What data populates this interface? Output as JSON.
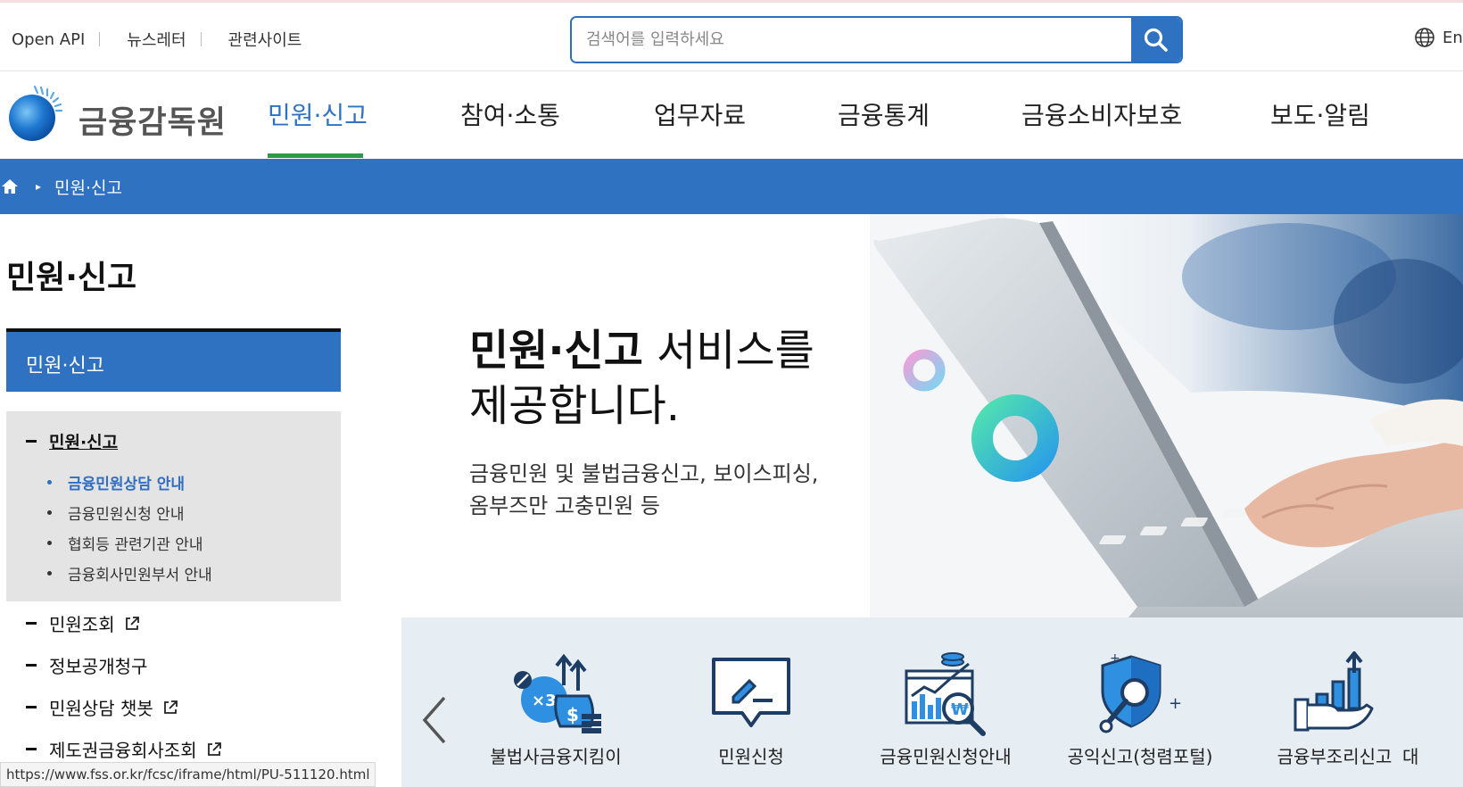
{
  "utility": {
    "links": [
      "Open API",
      "뉴스레터",
      "관련사이트"
    ],
    "search_placeholder": "검색어를 입력하세요",
    "lang_label": "En"
  },
  "header": {
    "logo_text": "금융감독원",
    "gnb": [
      "민원·신고",
      "참여·소통",
      "업무자료",
      "금융통계",
      "금융소비자보호",
      "보도·알림"
    ],
    "active_index": 0
  },
  "breadcrumb": {
    "current": "민원·신고"
  },
  "sidebar": {
    "title": "민원·신고",
    "box_title": "민원·신고",
    "current_group": "민원·신고",
    "sub_items": [
      "금융민원상담 안내",
      "금융민원신청 안내",
      "협회등 관련기관 안내",
      "금융회사민원부서 안내"
    ],
    "active_sub_index": 0,
    "other_items": [
      "민원조회",
      "정보공개청구",
      "민원상담 챗봇",
      "제도권금융회사조회"
    ]
  },
  "hero": {
    "title_bold": "민원·신고",
    "title_rest": " 서비스를",
    "title_line2": "제공합니다.",
    "desc_line1": "금융민원 및 불법금융신고, 보이스피싱,",
    "desc_line2": "옴부즈만 고충민원 등"
  },
  "quick_menu": {
    "items": [
      "불법사금융지킴이",
      "민원신청",
      "금융민원신청안내",
      "공익신고(청렴포털)",
      "금융부조리신고",
      "대"
    ]
  },
  "status_bar": {
    "url": "https://www.fss.or.kr/fcsc/iframe/html/PU-511120.html"
  },
  "colors": {
    "primary_blue": "#2f72c2",
    "active_underline": "#2d9a4b",
    "quick_bg": "#e6edf3"
  }
}
